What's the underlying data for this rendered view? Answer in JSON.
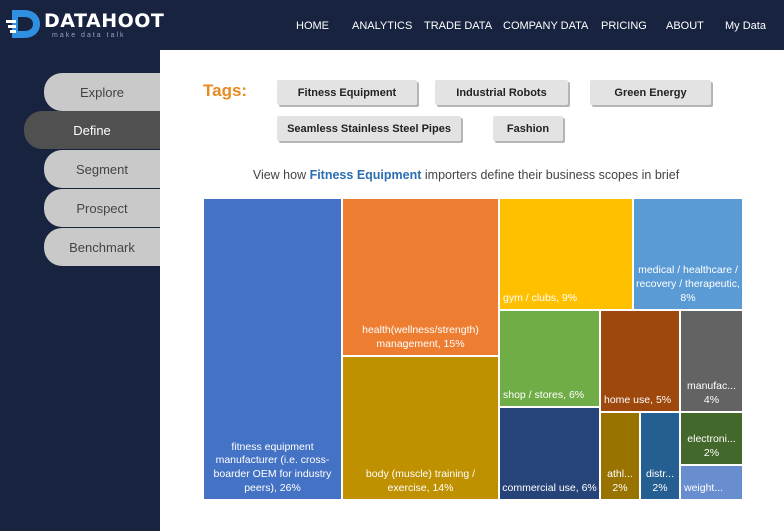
{
  "brand": {
    "name": "DATAHOOT",
    "tagline": "make data talk"
  },
  "nav": {
    "items": [
      "HOME",
      "ANALYTICS",
      "TRADE DATA",
      "COMPANY DATA",
      "PRICING",
      "ABOUT",
      "My Data"
    ]
  },
  "sidebar": {
    "items": [
      "Explore",
      "Define",
      "Segment",
      "Prospect",
      "Benchmark"
    ],
    "active": "Define"
  },
  "tags": {
    "label": "Tags:",
    "items": [
      "Fitness Equipment",
      "Industrial Robots",
      "Green Energy",
      "Seamless Stainless Steel Pipes",
      "Fashion"
    ]
  },
  "headline": {
    "prefix": "View how ",
    "highlight": "Fitness Equipment",
    "suffix": " importers define their business scopes in brief"
  },
  "chart_data": {
    "type": "treemap",
    "cells": [
      {
        "label": "fitness equipment manufacturer  (i.e. cross-boarder OEM for industry peers), 26%",
        "value": 26,
        "color": "#4472c4"
      },
      {
        "label": "health(wellness/strength) management, 15%",
        "value": 15,
        "color": "#ed7d31"
      },
      {
        "label": "body (muscle) training / exercise, 14%",
        "value": 14,
        "color": "#bf9000"
      },
      {
        "label": "gym / clubs, 9%",
        "value": 9,
        "color": "#ffc000"
      },
      {
        "label": "medical / healthcare / recovery / therapeutic, 8%",
        "value": 8,
        "color": "#5b9bd5"
      },
      {
        "label": "shop / stores, 6%",
        "value": 6,
        "color": "#70ad47"
      },
      {
        "label": "commercial use, 6%",
        "value": 6,
        "color": "#264478"
      },
      {
        "label": "home use, 5%",
        "value": 5,
        "color": "#9e480e"
      },
      {
        "label": "manufac... 4%",
        "value": 4,
        "color": "#636363"
      },
      {
        "label": "athl... 2%",
        "value": 2,
        "color": "#997300"
      },
      {
        "label": "distr... 2%",
        "value": 2,
        "color": "#255e91"
      },
      {
        "label": "electroni... 2%",
        "value": 2,
        "color": "#43682b"
      },
      {
        "label": "weight...",
        "value": 2,
        "color": "#698ed0"
      }
    ]
  }
}
